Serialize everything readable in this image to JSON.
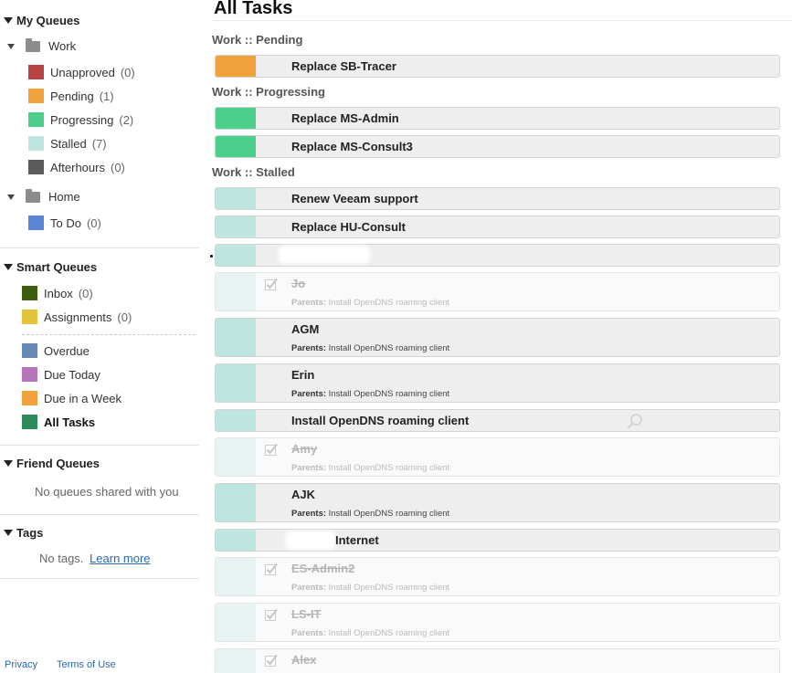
{
  "sidebar": {
    "my_queues": {
      "heading": "My Queues",
      "folders": [
        {
          "name": "Work",
          "queues": [
            {
              "label": "Unapproved",
              "count": "(0)",
              "color": "#b84343"
            },
            {
              "label": "Pending",
              "count": "(1)",
              "color": "#f0a33c"
            },
            {
              "label": "Progressing",
              "count": "(2)",
              "color": "#4bcf8a"
            },
            {
              "label": "Stalled",
              "count": "(7)",
              "color": "#bfe5e1"
            },
            {
              "label": "Afterhours",
              "count": "(0)",
              "color": "#5c5c5c"
            }
          ]
        },
        {
          "name": "Home",
          "queues": [
            {
              "label": "To Do",
              "count": "(0)",
              "color": "#5b86d6"
            }
          ]
        }
      ]
    },
    "smart_queues": {
      "heading": "Smart Queues",
      "queues": [
        {
          "label": "Inbox",
          "count": "(0)",
          "color": "#3b5c0e"
        },
        {
          "label": "Assignments",
          "count": "(0)",
          "color": "#e2c43d"
        },
        {
          "label": "Overdue",
          "count": "",
          "color": "#6688b5"
        },
        {
          "label": "Due Today",
          "count": "",
          "color": "#b774bb"
        },
        {
          "label": "Due in a Week",
          "count": "",
          "color": "#f0a33c"
        },
        {
          "label": "All Tasks",
          "count": "",
          "color": "#2d8a5a"
        }
      ]
    },
    "friend_queues": {
      "heading": "Friend Queues",
      "empty": "No queues shared with you"
    },
    "tags": {
      "heading": "Tags",
      "empty": "No tags.",
      "learn_more": "Learn more"
    },
    "footer": {
      "privacy": "Privacy",
      "terms": "Terms of Use"
    }
  },
  "main": {
    "title": "All Tasks",
    "groups": [
      {
        "label": "Work :: Pending"
      },
      {
        "label": "Work :: Progressing"
      },
      {
        "label": "Work :: Stalled"
      }
    ],
    "tasks": [
      {
        "title": "Replace SB-Tracer",
        "color": "#f0a33c"
      },
      {
        "title": "Replace MS-Admin",
        "color": "#4bcf8a"
      },
      {
        "title": "Replace MS-Consult3",
        "color": "#4bcf8a"
      },
      {
        "title": "Renew Veeam support",
        "color": "#bfe5e1"
      },
      {
        "title": "Replace HU-Consult",
        "color": "#bfe5e1"
      },
      {
        "title": "",
        "color": "#bfe5e1"
      },
      {
        "title": "Jo",
        "parents_label": "Parents:",
        "parents": "Install OpenDNS roaming client",
        "done": true
      },
      {
        "title": "AGM",
        "parents_label": "Parents:",
        "parents": "Install OpenDNS roaming client",
        "color": "#bfe5e1"
      },
      {
        "title": "Erin",
        "parents_label": "Parents:",
        "parents": "Install OpenDNS roaming client",
        "color": "#bfe5e1"
      },
      {
        "title": "Install OpenDNS roaming client",
        "color": "#bfe5e1"
      },
      {
        "title": "Amy",
        "parents_label": "Parents:",
        "parents": "Install OpenDNS roaming client",
        "done": true
      },
      {
        "title": "AJK",
        "parents_label": "Parents:",
        "parents": "Install OpenDNS roaming client",
        "color": "#bfe5e1"
      },
      {
        "title": "Internet",
        "color": "#bfe5e1"
      },
      {
        "title": "ES-Admin2",
        "parents_label": "Parents:",
        "parents": "Install OpenDNS roaming client",
        "done": true
      },
      {
        "title": "LS-IT",
        "parents_label": "Parents:",
        "parents": "Install OpenDNS roaming client",
        "done": true
      },
      {
        "title": "Alex",
        "done": true
      }
    ]
  }
}
